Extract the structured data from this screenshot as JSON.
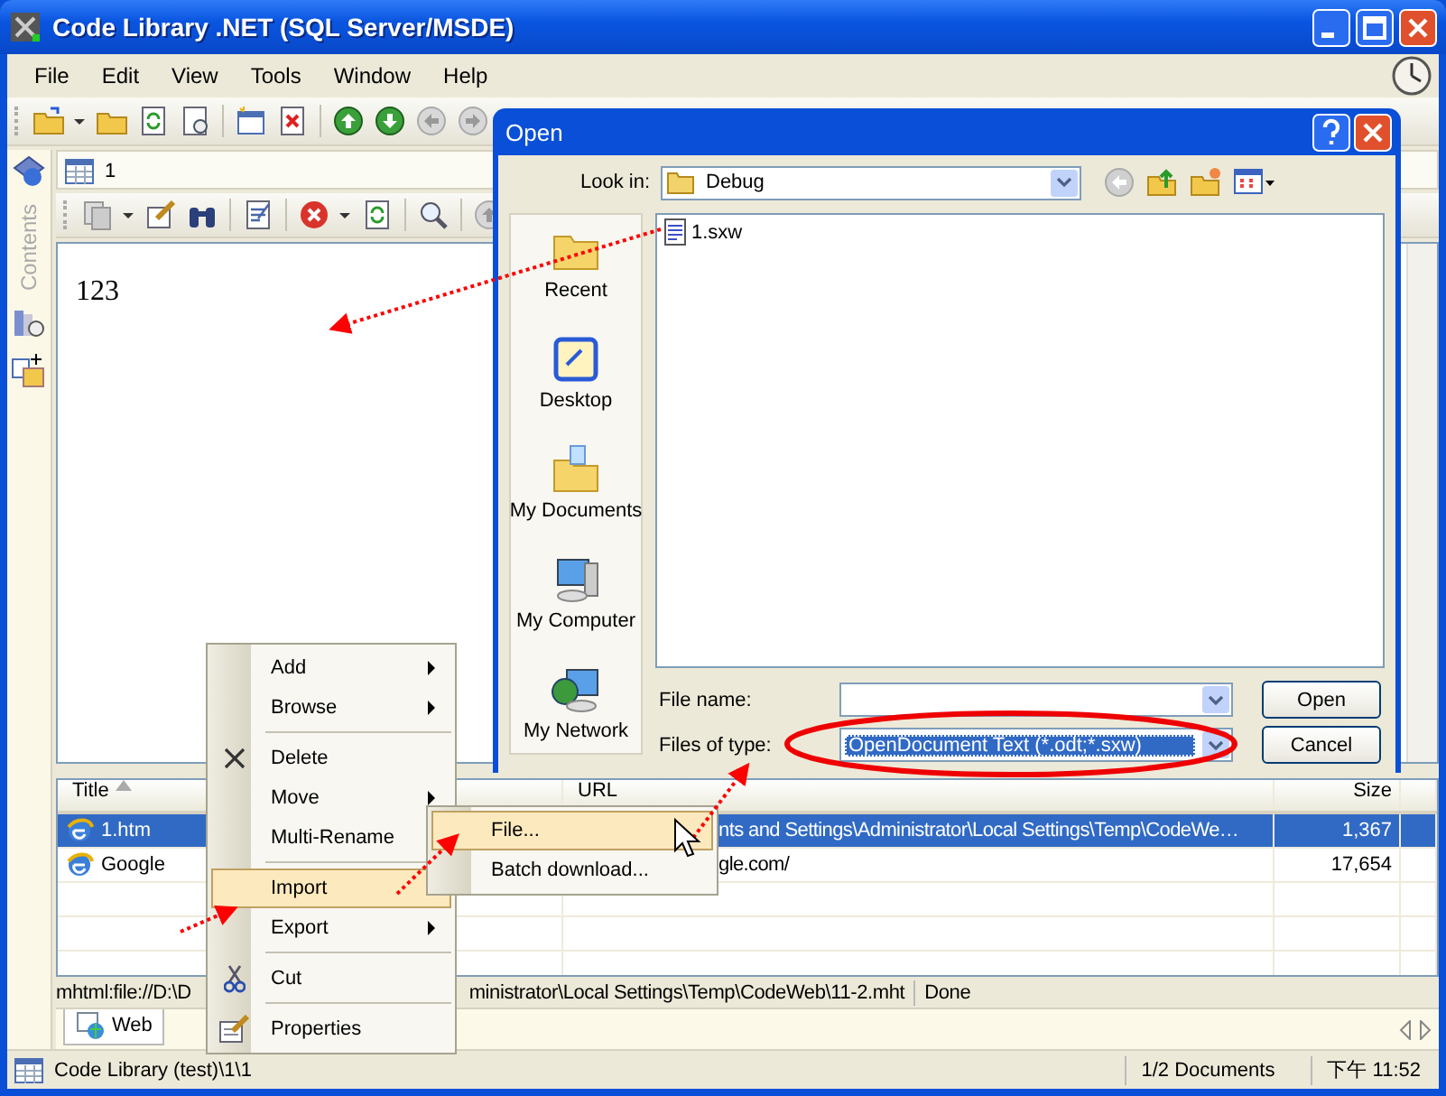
{
  "window": {
    "title": "Code Library .NET (SQL Server/MSDE)"
  },
  "menu_bar": [
    "File",
    "Edit",
    "View",
    "Tools",
    "Window",
    "Help"
  ],
  "sidebar": {
    "label": "Contents"
  },
  "document_tab": {
    "label": "1"
  },
  "editor": {
    "text": "123"
  },
  "list": {
    "columns": [
      {
        "label": "Title",
        "sorted": true
      },
      {
        "label": "URL",
        "sorted": false
      },
      {
        "label": "Size",
        "sorted": false
      }
    ],
    "rows": [
      {
        "title": "1.htm",
        "url": "nts and Settings\\Administrator\\Local Settings\\Temp\\CodeWe…",
        "size": "1,367",
        "selected": true
      },
      {
        "title": "Google",
        "url": "gle.com/",
        "size": "17,654",
        "selected": false
      }
    ]
  },
  "status_path": {
    "start": "mhtml:file://D:\\D",
    "end": "ministrator\\Local Settings\\Temp\\CodeWeb\\11-2.mht",
    "state": "Done"
  },
  "bottom_tabs": [
    {
      "label": "Web",
      "selected": true
    }
  ],
  "status_bar": {
    "path": "Code Library (test)\\1\\1",
    "documents": "1/2 Documents",
    "time": "下午 11:52"
  },
  "open_dialog": {
    "title": "Open",
    "look_in_label": "Look in:",
    "look_in": "Debug",
    "places": [
      "Recent",
      "Desktop",
      "My Documents",
      "My Computer",
      "My Network"
    ],
    "files": [
      "1.sxw"
    ],
    "file_name_label": "File name:",
    "file_type_label": "Files of type:",
    "file_type": "OpenDocument Text (*.odt;*.sxw)",
    "file_type_selected": true,
    "buttons": [
      "Open",
      "Cancel"
    ]
  },
  "context_menu": {
    "items": [
      {
        "kind": "item",
        "label": "Add",
        "submenu": true,
        "selected": false
      },
      {
        "kind": "item",
        "label": "Browse",
        "submenu": true,
        "selected": false
      },
      {
        "kind": "separator"
      },
      {
        "kind": "item",
        "label": "Delete",
        "submenu": false,
        "selected": false
      },
      {
        "kind": "item",
        "label": "Move",
        "submenu": true,
        "selected": false
      },
      {
        "kind": "item",
        "label": "Multi-Rename",
        "submenu": false,
        "selected": false
      },
      {
        "kind": "separator"
      },
      {
        "kind": "item",
        "label": "Import",
        "submenu": true,
        "selected": true
      },
      {
        "kind": "item",
        "label": "Export",
        "submenu": true,
        "selected": false
      },
      {
        "kind": "separator"
      },
      {
        "kind": "item",
        "label": "Cut",
        "submenu": false,
        "selected": false
      },
      {
        "kind": "separator"
      },
      {
        "kind": "item",
        "label": "Properties",
        "submenu": false,
        "selected": false
      }
    ]
  },
  "submenu": {
    "items": [
      {
        "label": "File...",
        "selected": true
      },
      {
        "label": "Batch download...",
        "selected": false
      }
    ]
  }
}
